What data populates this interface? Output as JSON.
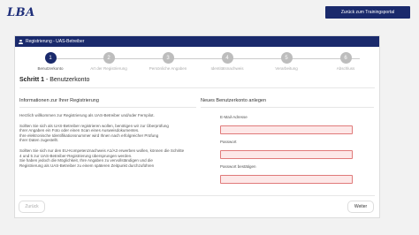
{
  "header": {
    "logo_text": "LBA",
    "portal_button": "Zurück zum Trainingsportal"
  },
  "card": {
    "title": "Registrierung - UAS-Betreiber",
    "steps": [
      {
        "number": "1",
        "label": "Benutzerkonto",
        "active": true
      },
      {
        "number": "2",
        "label": "Art der Registrierung",
        "active": false
      },
      {
        "number": "3",
        "label": "Persönliche Angaben",
        "active": false
      },
      {
        "number": "4",
        "label": "Identitätsnachweis",
        "active": false
      },
      {
        "number": "5",
        "label": "Verarbeitung",
        "active": false
      },
      {
        "number": "6",
        "label": "Abschluss",
        "active": false
      }
    ],
    "step_title_bold": "Schritt 1",
    "step_title_rest": " - Benutzerkonto"
  },
  "info": {
    "title": "Informationen zur Ihrer Registrierung",
    "p1": "Herzlich willkommen zur Registrierung als UAS-Betreiber und/oder Fernpilot.",
    "p2_lines": [
      "Sollten Sie sich als UAS-Betreiber registrieren wollen, benötigen wir zur Überprüfung",
      "Ihrer Angaben ein Foto oder einen Scan eines Ausweisdokumentes.",
      "Ihre elektronische Identifikationsnummer wird Ihnen nach erfolgreicher Prüfung",
      "Ihrer Daten zugestellt."
    ],
    "p3_lines": [
      "Sollten Sie sich nur den EU-Kompetenznachweis A1/A3 erwerben wollen, können die Schritte",
      "4 und 5 zur UAS-Betreiber-Registrierung übersprungen werden.",
      "Sie haben jedoch die Möglichkeit, Ihre Angaben zu vervollständigen und die",
      "Registrierung als UAS-Betreiber zu einem späteren Zeitpunkt durchzuführen"
    ]
  },
  "account": {
    "title": "Neues Benutzerkonto anlegen",
    "email_label": "E-Mail-Adresse",
    "email_value": "",
    "password_label": "Passwort",
    "password_value": "",
    "confirm_label": "Passwort bestätigen",
    "confirm_value": ""
  },
  "footer": {
    "back_label": "Zurück",
    "next_label": "Weiter"
  },
  "colors": {
    "primary": "#1a2a6c",
    "error_border": "#e07a7a",
    "error_bg": "#fde8e8"
  }
}
